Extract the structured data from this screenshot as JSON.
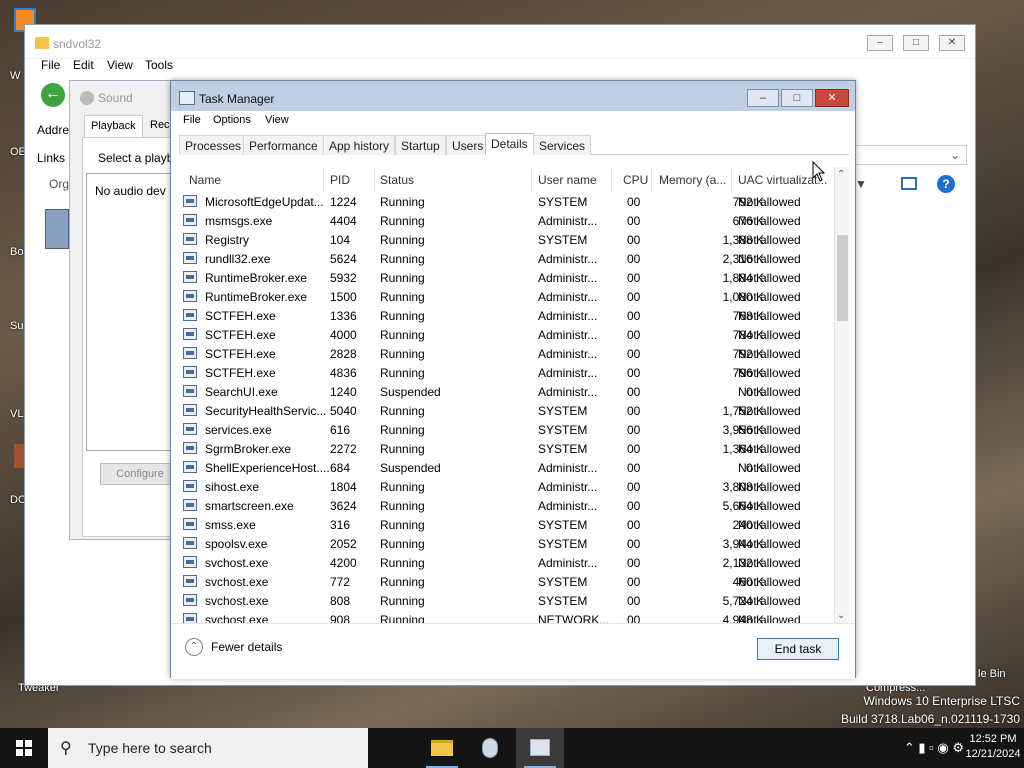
{
  "colors": {
    "titlebar": "#bfcfe4",
    "close_red": "#c9473b",
    "accent": "#3c7fb1",
    "taskbar": "#141414"
  },
  "desktop": {
    "labels": [
      "W",
      "OE",
      "Bo",
      "Su",
      "VL",
      "DOS",
      "Tweaker",
      "le Bin",
      "Compress..."
    ]
  },
  "explorer": {
    "title": "sndvol32",
    "menu": [
      "File",
      "Edit",
      "View",
      "Tools"
    ],
    "labels": {
      "address": "Addre",
      "links": "Links",
      "organize": "Org"
    }
  },
  "sound": {
    "title": "Sound",
    "tabs": [
      "Playback",
      "Reco"
    ],
    "select_text": "Select a playba",
    "list_text": "No audio dev",
    "configure": "Configure"
  },
  "taskmgr": {
    "title": "Task Manager",
    "menu": [
      "File",
      "Options",
      "View"
    ],
    "tabs": [
      "Processes",
      "Performance",
      "App history",
      "Startup",
      "Users",
      "Details",
      "Services"
    ],
    "active_tab": "Details",
    "columns": [
      "Name",
      "PID",
      "Status",
      "User name",
      "CPU",
      "Memory (a...",
      "UAC virtualizat..."
    ],
    "rows": [
      {
        "name": "MicrosoftEdgeUpdat...",
        "pid": "1224",
        "status": "Running",
        "user": "SYSTEM",
        "cpu": "00",
        "mem": "792 K",
        "uac": "Not allowed"
      },
      {
        "name": "msmsgs.exe",
        "pid": "4404",
        "status": "Running",
        "user": "Administr...",
        "cpu": "00",
        "mem": "676 K",
        "uac": "Not allowed"
      },
      {
        "name": "Registry",
        "pid": "104",
        "status": "Running",
        "user": "SYSTEM",
        "cpu": "00",
        "mem": "1,388 K",
        "uac": "Not allowed"
      },
      {
        "name": "rundll32.exe",
        "pid": "5624",
        "status": "Running",
        "user": "Administr...",
        "cpu": "00",
        "mem": "2,316 K",
        "uac": "Not allowed"
      },
      {
        "name": "RuntimeBroker.exe",
        "pid": "5932",
        "status": "Running",
        "user": "Administr...",
        "cpu": "00",
        "mem": "1,884 K",
        "uac": "Not allowed"
      },
      {
        "name": "RuntimeBroker.exe",
        "pid": "1500",
        "status": "Running",
        "user": "Administr...",
        "cpu": "00",
        "mem": "1,080 K",
        "uac": "Not allowed"
      },
      {
        "name": "SCTFEH.exe",
        "pid": "1336",
        "status": "Running",
        "user": "Administr...",
        "cpu": "00",
        "mem": "768 K",
        "uac": "Not allowed"
      },
      {
        "name": "SCTFEH.exe",
        "pid": "4000",
        "status": "Running",
        "user": "Administr...",
        "cpu": "00",
        "mem": "784 K",
        "uac": "Not allowed"
      },
      {
        "name": "SCTFEH.exe",
        "pid": "2828",
        "status": "Running",
        "user": "Administr...",
        "cpu": "00",
        "mem": "792 K",
        "uac": "Not allowed"
      },
      {
        "name": "SCTFEH.exe",
        "pid": "4836",
        "status": "Running",
        "user": "Administr...",
        "cpu": "00",
        "mem": "796 K",
        "uac": "Not allowed"
      },
      {
        "name": "SearchUI.exe",
        "pid": "1240",
        "status": "Suspended",
        "user": "Administr...",
        "cpu": "00",
        "mem": "0 K",
        "uac": "Not allowed"
      },
      {
        "name": "SecurityHealthServic...",
        "pid": "5040",
        "status": "Running",
        "user": "SYSTEM",
        "cpu": "00",
        "mem": "1,752 K",
        "uac": "Not allowed"
      },
      {
        "name": "services.exe",
        "pid": "616",
        "status": "Running",
        "user": "SYSTEM",
        "cpu": "00",
        "mem": "3,956 K",
        "uac": "Not allowed"
      },
      {
        "name": "SgrmBroker.exe",
        "pid": "2272",
        "status": "Running",
        "user": "SYSTEM",
        "cpu": "00",
        "mem": "1,364 K",
        "uac": "Not allowed"
      },
      {
        "name": "ShellExperienceHost....",
        "pid": "684",
        "status": "Suspended",
        "user": "Administr...",
        "cpu": "00",
        "mem": "0 K",
        "uac": "Not allowed"
      },
      {
        "name": "sihost.exe",
        "pid": "1804",
        "status": "Running",
        "user": "Administr...",
        "cpu": "00",
        "mem": "3,808 K",
        "uac": "Not allowed"
      },
      {
        "name": "smartscreen.exe",
        "pid": "3624",
        "status": "Running",
        "user": "Administr...",
        "cpu": "00",
        "mem": "5,664 K",
        "uac": "Not allowed"
      },
      {
        "name": "smss.exe",
        "pid": "316",
        "status": "Running",
        "user": "SYSTEM",
        "cpu": "00",
        "mem": "240 K",
        "uac": "Not allowed"
      },
      {
        "name": "spoolsv.exe",
        "pid": "2052",
        "status": "Running",
        "user": "SYSTEM",
        "cpu": "00",
        "mem": "3,944 K",
        "uac": "Not allowed"
      },
      {
        "name": "svchost.exe",
        "pid": "4200",
        "status": "Running",
        "user": "Administr...",
        "cpu": "00",
        "mem": "2,132 K",
        "uac": "Not allowed"
      },
      {
        "name": "svchost.exe",
        "pid": "772",
        "status": "Running",
        "user": "SYSTEM",
        "cpu": "00",
        "mem": "460 K",
        "uac": "Not allowed"
      },
      {
        "name": "svchost.exe",
        "pid": "808",
        "status": "Running",
        "user": "SYSTEM",
        "cpu": "00",
        "mem": "5,724 K",
        "uac": "Not allowed"
      },
      {
        "name": "svchost.exe",
        "pid": "908",
        "status": "Running",
        "user": "NETWORK...",
        "cpu": "00",
        "mem": "4,948 K",
        "uac": "Not allowed"
      }
    ],
    "fewer_details": "Fewer details",
    "end_task": "End task"
  },
  "watermark": {
    "line1": "Windows 10 Enterprise LTSC",
    "line2": "Build 3718.Lab06_n.021119-1730"
  },
  "taskbar": {
    "search_placeholder": "Type here to search",
    "time": "12:52 PM",
    "date": "12/21/2024",
    "icons": [
      "file-explorer-icon",
      "app-icon",
      "task-manager-icon"
    ]
  }
}
